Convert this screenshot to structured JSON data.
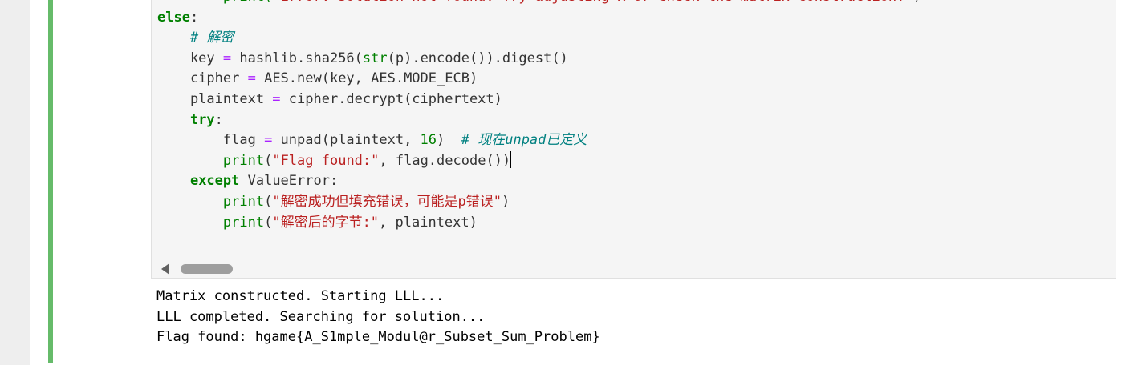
{
  "code_lines": [
    [
      {
        "t": "        print(",
        "c": "bi"
      },
      {
        "t": "\"Error: Solution not found. Try adjusting K or check the matrix construction.\"",
        "c": "str"
      },
      {
        "t": ")",
        "c": ""
      }
    ],
    [
      {
        "t": "else",
        "c": "kw"
      },
      {
        "t": ":",
        "c": ""
      }
    ],
    [
      {
        "t": "    ",
        "c": ""
      },
      {
        "t": "# 解密",
        "c": "cm"
      }
    ],
    [
      {
        "t": "    key ",
        "c": ""
      },
      {
        "t": "=",
        "c": "op"
      },
      {
        "t": " hashlib.sha256(",
        "c": ""
      },
      {
        "t": "str",
        "c": "bi"
      },
      {
        "t": "(p).encode()).digest()",
        "c": ""
      }
    ],
    [
      {
        "t": "    cipher ",
        "c": ""
      },
      {
        "t": "=",
        "c": "op"
      },
      {
        "t": " AES.new(key, AES.MODE_ECB)",
        "c": ""
      }
    ],
    [
      {
        "t": "    plaintext ",
        "c": ""
      },
      {
        "t": "=",
        "c": "op"
      },
      {
        "t": " cipher.decrypt(ciphertext)",
        "c": ""
      }
    ],
    [
      {
        "t": "    ",
        "c": ""
      },
      {
        "t": "try",
        "c": "kw"
      },
      {
        "t": ":",
        "c": ""
      }
    ],
    [
      {
        "t": "        flag ",
        "c": ""
      },
      {
        "t": "=",
        "c": "op"
      },
      {
        "t": " unpad(plaintext, ",
        "c": ""
      },
      {
        "t": "16",
        "c": "num"
      },
      {
        "t": ")  ",
        "c": ""
      },
      {
        "t": "# 现在unpad已定义",
        "c": "cm"
      }
    ],
    [
      {
        "t": "        ",
        "c": ""
      },
      {
        "t": "print",
        "c": "bi"
      },
      {
        "t": "(",
        "c": ""
      },
      {
        "t": "\"Flag found:\"",
        "c": "str"
      },
      {
        "t": ", flag.decode())",
        "c": ""
      },
      {
        "t": "",
        "c": "cursor"
      }
    ],
    [
      {
        "t": "    ",
        "c": ""
      },
      {
        "t": "except",
        "c": "kw"
      },
      {
        "t": " ValueError:",
        "c": ""
      }
    ],
    [
      {
        "t": "        ",
        "c": ""
      },
      {
        "t": "print",
        "c": "bi"
      },
      {
        "t": "(",
        "c": ""
      },
      {
        "t": "\"解密成功但填充错误，可能是p错误\"",
        "c": "str"
      },
      {
        "t": ")",
        "c": ""
      }
    ],
    [
      {
        "t": "        ",
        "c": ""
      },
      {
        "t": "print",
        "c": "bi"
      },
      {
        "t": "(",
        "c": ""
      },
      {
        "t": "\"解密后的字节:\"",
        "c": "str"
      },
      {
        "t": ", plaintext)",
        "c": ""
      }
    ]
  ],
  "output_lines": [
    "Matrix constructed. Starting LLL...",
    "LLL completed. Searching for solution...",
    "Flag found: hgame{A_S1mple_Modul@r_Subset_Sum_Problem}"
  ],
  "icons": {
    "scroll_left": "triangle-left-icon"
  },
  "colors": {
    "cell_selected_bar": "#66bb6a",
    "keyword": "#008000",
    "string": "#ba2121",
    "comment": "#008080",
    "operator": "#aa22ff"
  }
}
